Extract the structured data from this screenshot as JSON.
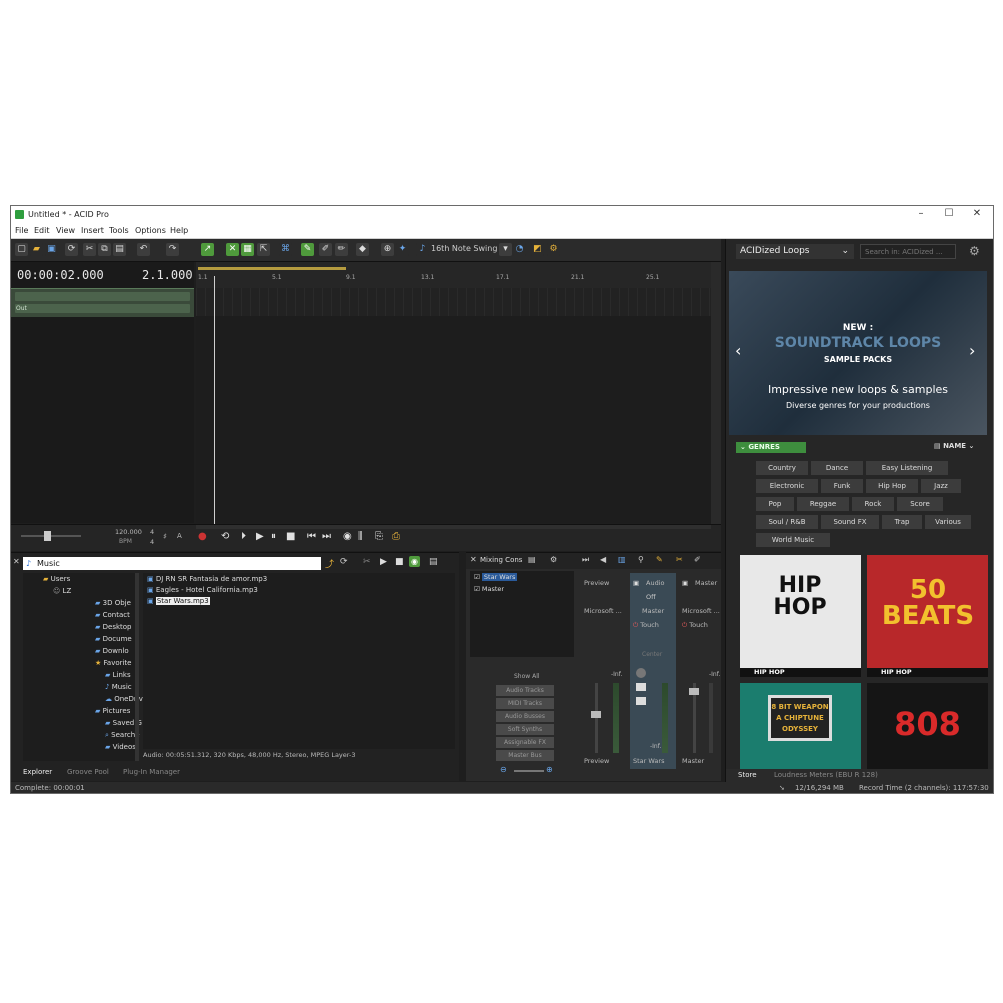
{
  "window": {
    "title": "Untitled * - ACID Pro",
    "controls": [
      "–",
      "☐",
      "✕"
    ]
  },
  "menu": [
    "File",
    "Edit",
    "View",
    "Insert",
    "Tools",
    "Options",
    "Help"
  ],
  "toolbar": {
    "swing_label": "16th Note Swing"
  },
  "timeline": {
    "time": "00:00:02.000",
    "position": "2.1.000",
    "ruler_ticks": [
      "1.1",
      "5.1",
      "9.1",
      "13.1",
      "17.1",
      "21.1",
      "25.1"
    ],
    "tempo": "120.000",
    "tempo_unit": "BPM",
    "meter_top": "4",
    "meter_bottom": "4",
    "key": "A",
    "track_out_label": "Out"
  },
  "explorer": {
    "path": "Music",
    "tree": [
      {
        "label": "Users",
        "icon": "folder-icon"
      },
      {
        "label": "LZ",
        "icon": "user-icon"
      },
      {
        "label": "3D Obje",
        "icon": "folder-icon"
      },
      {
        "label": "Contact",
        "icon": "folder-icon"
      },
      {
        "label": "Desktop",
        "icon": "folder-icon"
      },
      {
        "label": "Docume",
        "icon": "folder-icon"
      },
      {
        "label": "Downlo",
        "icon": "folder-icon"
      },
      {
        "label": "Favorite",
        "icon": "star-icon"
      },
      {
        "label": "Links",
        "icon": "folder-icon"
      },
      {
        "label": "Music",
        "icon": "music-icon"
      },
      {
        "label": "OneDriv",
        "icon": "cloud-icon"
      },
      {
        "label": "Pictures",
        "icon": "folder-icon"
      },
      {
        "label": "Saved G",
        "icon": "folder-icon"
      },
      {
        "label": "Searche",
        "icon": "search-icon"
      },
      {
        "label": "Videos",
        "icon": "folder-icon"
      }
    ],
    "files": [
      "DJ RN SR Fantasia de amor.mp3",
      "Eagles - Hotel California.mp3",
      "Star Wars.mp3"
    ],
    "selected_file": "Star Wars.mp3",
    "audio_info": "Audio: 00:05:51.312, 320 Kbps, 48,000 Hz, Stereo, MPEG Layer-3",
    "tabs": [
      "Explorer",
      "Groove Pool",
      "Plug-In Manager"
    ]
  },
  "mixer": {
    "title": "Mixing Cons",
    "tracks": [
      "Star Wars",
      "Master"
    ],
    "show_all": "Show All",
    "filters": [
      "Audio Tracks",
      "MIDI Tracks",
      "Audio Busses",
      "Soft Synths",
      "Assignable FX",
      "Master Bus"
    ],
    "strips": [
      {
        "top": "Preview",
        "device": "Microsoft ...",
        "bottom": "Preview",
        "gain": "-Inf."
      },
      {
        "top": "Audio",
        "mode": "Off",
        "device": "Master",
        "auto": "Touch",
        "bottom": "Star Wars",
        "gain": "-Inf.",
        "center": "Center"
      },
      {
        "top": "Master",
        "device": "Microsoft ...",
        "auto": "Touch",
        "bottom": "Master",
        "gain": "-Inf."
      }
    ]
  },
  "store": {
    "dropdown": "ACIDized Loops",
    "search_placeholder": "Search in: ACIDized ...",
    "banner": {
      "kicker": "NEW :",
      "headline": "SOUNDTRACK LOOPS",
      "sub": "SAMPLE PACKS",
      "tagline": "Impressive new loops & samples",
      "tagline2": "Diverse genres for your productions"
    },
    "genres_label": "GENRES",
    "sort_label": "NAME",
    "genres": [
      "Country",
      "Dance",
      "Easy Listening",
      "Electronic",
      "Funk",
      "Hip Hop",
      "Jazz",
      "Pop",
      "Reggae",
      "Rock",
      "Score",
      "Soul / R&B",
      "Sound FX",
      "Trap",
      "Various",
      "World Music"
    ],
    "cards": [
      {
        "art": "HIP HOP",
        "label": "HIP HOP",
        "bg": "#e8e8e8"
      },
      {
        "art": "50 BEATS",
        "label": "HIP HOP",
        "bg": "#b8282a"
      },
      {
        "art": "8 BIT WEAPON A CHIPTUNE ODYSSEY",
        "label": "",
        "bg": "#1b7d6e"
      },
      {
        "art": "808",
        "label": "",
        "bg": "#151515"
      }
    ],
    "tabs": [
      "Store",
      "Loudness Meters (EBU R 128)"
    ]
  },
  "status": {
    "left": "Complete: 00:00:01",
    "memory": "12/16,294 MB",
    "record": "Record Time (2 channels): 117:57:30"
  },
  "colors": {
    "accent_green": "#4f9a3c",
    "panel_dark": "#1e1e1e",
    "genre_badge": "#3e8e3e"
  }
}
